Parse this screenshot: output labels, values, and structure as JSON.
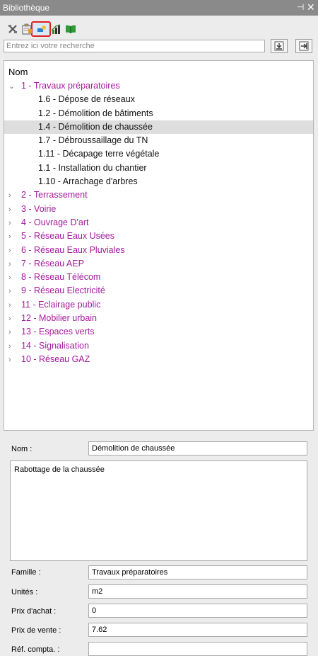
{
  "window": {
    "title": "Bibliothèque",
    "pin_glyph": "⊣",
    "close_glyph": "✕"
  },
  "toolbar": {
    "icons": [
      "tools-icon",
      "clipboard-icon",
      "shapes-icon",
      "chart-icon",
      "book-icon"
    ],
    "active_index": 2
  },
  "search": {
    "placeholder": "Entrez ici votre recherche",
    "value": ""
  },
  "tree": {
    "header": "Nom",
    "categories": [
      {
        "label": "1 - Travaux préparatoires",
        "expanded": true,
        "children": [
          "1.6 - Dépose de réseaux",
          "1.2 - Démolition de bâtiments",
          "1.4 - Démolition de chaussée",
          "1.7 - Débroussaillage du TN",
          "1.11 - Décapage terre végétale",
          "1.1 - Installation du chantier",
          "1.10 - Arrachage d'arbres"
        ],
        "selected_child": 2
      },
      {
        "label": "2 - Terrassement",
        "expanded": false
      },
      {
        "label": "3 - Voirie",
        "expanded": false
      },
      {
        "label": "4 - Ouvrage D'art",
        "expanded": false
      },
      {
        "label": "5 - Réseau Eaux Usées",
        "expanded": false
      },
      {
        "label": "6 - Réseau Eaux Pluviales",
        "expanded": false
      },
      {
        "label": "7 - Réseau AEP",
        "expanded": false
      },
      {
        "label": "8 - Réseau Télécom",
        "expanded": false
      },
      {
        "label": "9 - Réseau Electricité",
        "expanded": false
      },
      {
        "label": "11 - Eclairage public",
        "expanded": false
      },
      {
        "label": "12 - Mobilier urbain",
        "expanded": false
      },
      {
        "label": "13 - Espaces verts",
        "expanded": false
      },
      {
        "label": "14 - Signalisation",
        "expanded": false
      },
      {
        "label": "10 - Réseau GAZ",
        "expanded": false
      }
    ]
  },
  "details": {
    "nom_label": "Nom :",
    "nom_value": "Démolition de chaussée",
    "description": "Rabottage de la chaussée",
    "famille_label": "Famille :",
    "famille_value": "Travaux préparatoires",
    "unites_label": "Unités :",
    "unites_value": "m2",
    "prix_achat_label": "Prix d'achat :",
    "prix_achat_value": "0",
    "prix_vente_label": "Prix de vente :",
    "prix_vente_value": "7.62",
    "ref_compta_label": "Réf. compta. :",
    "ref_compta_value": ""
  },
  "colors": {
    "category": "#a31a9d",
    "selection": "#dedede",
    "titlebar": "#8a8a8a",
    "active_outline": "#e02020"
  }
}
